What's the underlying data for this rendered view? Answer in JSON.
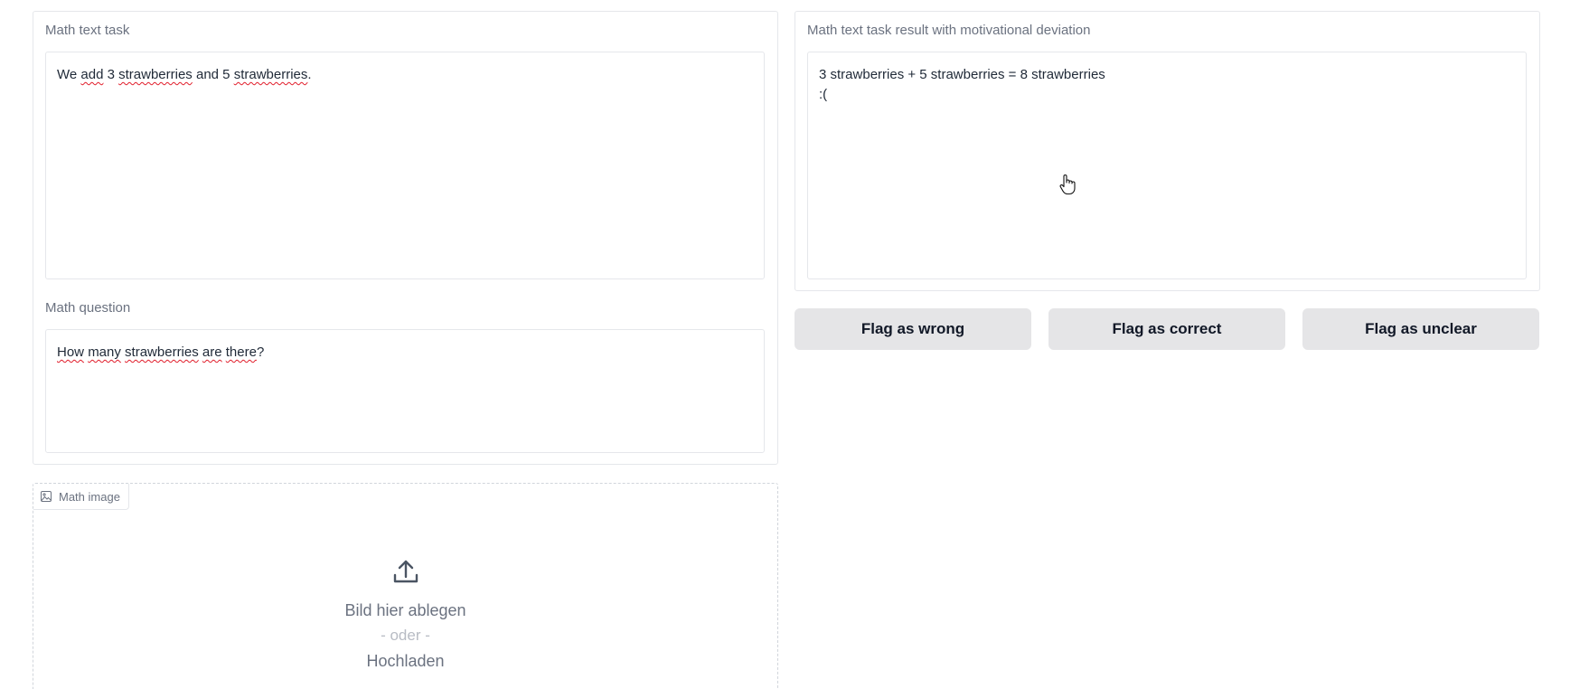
{
  "left_panel": {
    "task": {
      "label": "Math text task",
      "value_parts": [
        {
          "text": "We ",
          "squiggle": false
        },
        {
          "text": "add",
          "squiggle": true
        },
        {
          "text": " 3 ",
          "squiggle": false
        },
        {
          "text": "strawberries",
          "squiggle": true
        },
        {
          "text": " and 5 ",
          "squiggle": false
        },
        {
          "text": "strawberries",
          "squiggle": true
        },
        {
          "text": ".",
          "squiggle": false
        }
      ]
    },
    "question": {
      "label": "Math question",
      "value_parts": [
        {
          "text": "How",
          "squiggle": true
        },
        {
          "text": " ",
          "squiggle": false
        },
        {
          "text": "many",
          "squiggle": true
        },
        {
          "text": " ",
          "squiggle": false
        },
        {
          "text": "strawberries",
          "squiggle": true
        },
        {
          "text": " ",
          "squiggle": false
        },
        {
          "text": "are",
          "squiggle": true
        },
        {
          "text": " ",
          "squiggle": false
        },
        {
          "text": "there",
          "squiggle": true
        },
        {
          "text": "?",
          "squiggle": false
        }
      ]
    }
  },
  "right_panel": {
    "result": {
      "label": "Math text task result with motivational deviation",
      "line1": "3 strawberries + 5 strawberries = 8 strawberries",
      "line2": ":("
    }
  },
  "buttons": {
    "wrong": "Flag as wrong",
    "correct": "Flag as correct",
    "unclear": "Flag as unclear"
  },
  "image_upload": {
    "label": "Math image",
    "drop_text": "Bild hier ablegen",
    "or_text": "- oder -",
    "upload_text": "Hochladen"
  },
  "icons": {
    "image": "image-icon",
    "upload": "upload-icon",
    "cursor": "hand-pointer-icon"
  },
  "colors": {
    "button_bg": "#e5e5e7",
    "border": "#e5e7eb",
    "label": "#6b7280",
    "spellcheck": "#e11d2a"
  }
}
